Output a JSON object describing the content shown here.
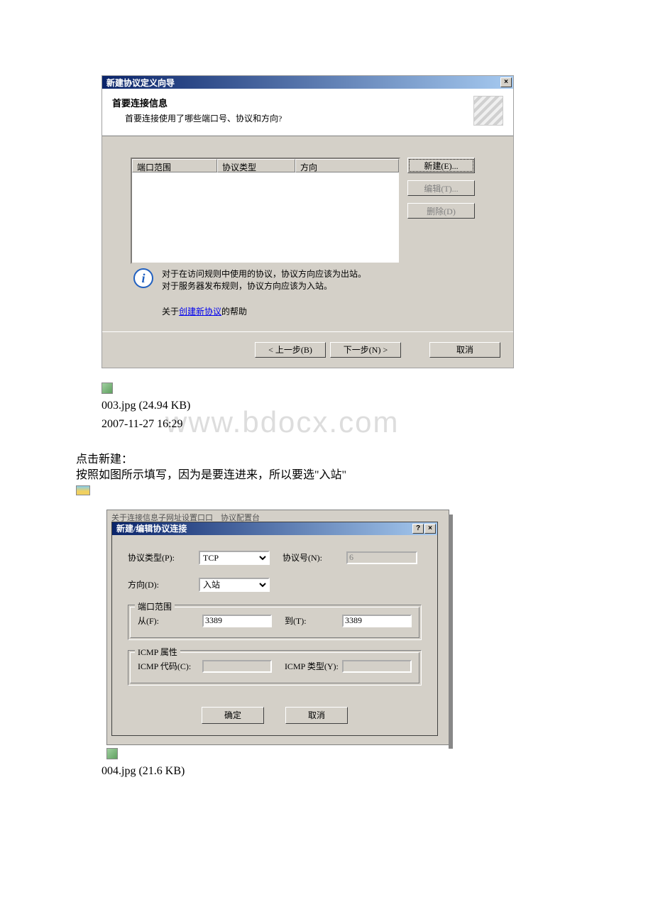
{
  "dialog1": {
    "title": "新建协议定义向导",
    "close": "×",
    "header": {
      "h1": "首要连接信息",
      "h2": "首要连接使用了哪些端口号、协议和方向?"
    },
    "columns": {
      "c1": "端口范围",
      "c2": "协议类型",
      "c3": "方向"
    },
    "buttons": {
      "new": "新建(E)...",
      "edit": "编辑(T)...",
      "delete": "删除(D)"
    },
    "info": {
      "line1": "对于在访问规则中使用的协议，协议方向应该为出站。",
      "line2": "对于服务器发布规则，协议方向应该为入站。"
    },
    "help_prefix": "关于",
    "help_link": "创建新协议",
    "help_suffix": "的帮助",
    "footer": {
      "back": "< 上一步(B)",
      "next": "下一步(N) >",
      "cancel": "取消"
    }
  },
  "mid": {
    "caption1": "003.jpg (24.94 KB)",
    "caption2": "2007-11-27 16:29",
    "watermark": "www.bdocx.com",
    "body1": "点击新建：",
    "body2": "按照如图所示填写，因为是要连进来，所以要选\"入站\""
  },
  "dialog2": {
    "partial_top": "关于连接信息子网址设置口口　协议配置台",
    "title": "新建/编辑协议连接",
    "help": "?",
    "close": "×",
    "labels": {
      "protocol_type": "协议类型(P):",
      "protocol_num": "协议号(N):",
      "direction": "方向(D):",
      "port_range": "端口范围",
      "from": "从(F):",
      "to": "到(T):",
      "icmp_attr": "ICMP 属性",
      "icmp_code": "ICMP 代码(C):",
      "icmp_type": "ICMP 类型(Y):"
    },
    "values": {
      "protocol_type": "TCP",
      "protocol_num": "6",
      "direction": "入站",
      "from": "3389",
      "to": "3389",
      "icmp_code": "",
      "icmp_type": ""
    },
    "footer": {
      "ok": "确定",
      "cancel": "取消"
    }
  },
  "caption4": "004.jpg (21.6 KB)"
}
